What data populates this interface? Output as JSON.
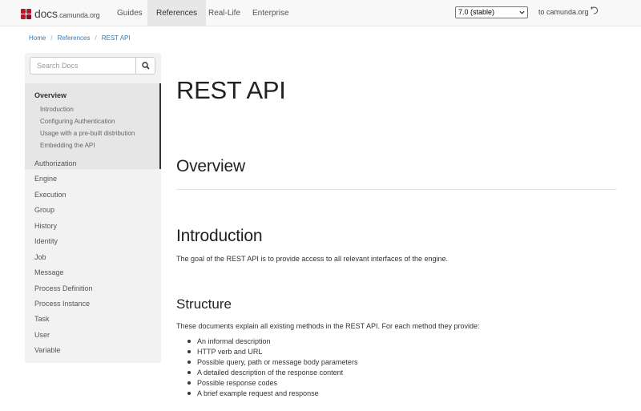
{
  "brand": {
    "name": "docs",
    "domain": ".camunda.org",
    "logo_color": "#b5152b"
  },
  "nav": {
    "items": [
      {
        "label": "Guides",
        "active": false
      },
      {
        "label": "References",
        "active": true
      },
      {
        "label": "Real-Life",
        "active": false
      },
      {
        "label": "Enterprise",
        "active": false
      }
    ],
    "version_select": {
      "value": "7.0 (stable)"
    },
    "to_camunda": "to camunda.org"
  },
  "breadcrumb": [
    "Home",
    "References",
    "REST API"
  ],
  "sidebar": {
    "search": {
      "placeholder": "Search Docs"
    },
    "active_item": "Overview",
    "sub_items": [
      "Introduction",
      "Configuring Authentication",
      "Usage with a pre-built distribution",
      "Embedding the API"
    ],
    "items": [
      "Authorization",
      "Engine",
      "Execution",
      "Group",
      "History",
      "Identity",
      "Job",
      "Message",
      "Process Definition",
      "Process Instance",
      "Task",
      "User",
      "Variable"
    ]
  },
  "main": {
    "title": "REST API",
    "overview_heading": "Overview",
    "intro_heading": "Introduction",
    "intro_text": "The goal of the REST API is to provide access to all relevant interfaces of the engine.",
    "structure_heading": "Structure",
    "structure_text": "These documents explain all existing methods in the REST API. For each method they provide:",
    "structure_list": [
      "An informal description",
      "HTTP verb and URL",
      "Possible query, path or message body parameters",
      "A detailed description of the response content",
      "Possible response codes",
      "A brief example request and response"
    ]
  },
  "colors": {
    "link": "#337ab7",
    "nav_bg": "#f8f8f8",
    "sidebar_bg": "#f2f2f2"
  }
}
